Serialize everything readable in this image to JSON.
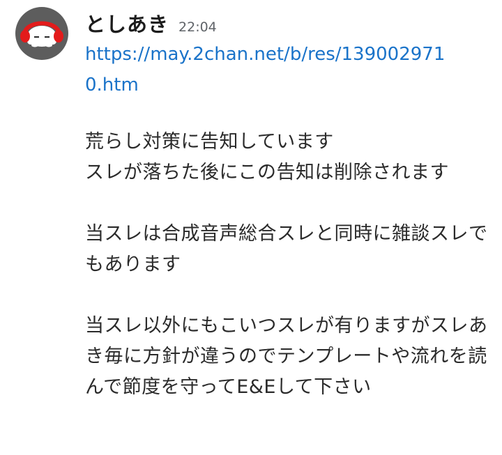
{
  "message": {
    "author": "としあき",
    "timestamp": "22:04",
    "link": "https://may.2chan.net/b/res/1390029710.htm",
    "paragraphs": [
      "荒らし対策に告知しています\nスレが落ちた後にこの告知は削除されます",
      "当スレは合成音声総合スレと同時に雑談スレでもあります",
      "当スレ以外にもこいつスレが有りますがスレあき毎に方針が違うのでテンプレートや流れを読んで節度を守ってE&Eして下さい"
    ]
  },
  "colors": {
    "avatar_bg": "#5d5d5d",
    "avatar_headphones": "#e31b1b",
    "link": "#1a73c9",
    "text": "#2b2b2b",
    "timestamp": "#5f6368"
  },
  "icons": {
    "avatar": "headphones-character-avatar"
  }
}
